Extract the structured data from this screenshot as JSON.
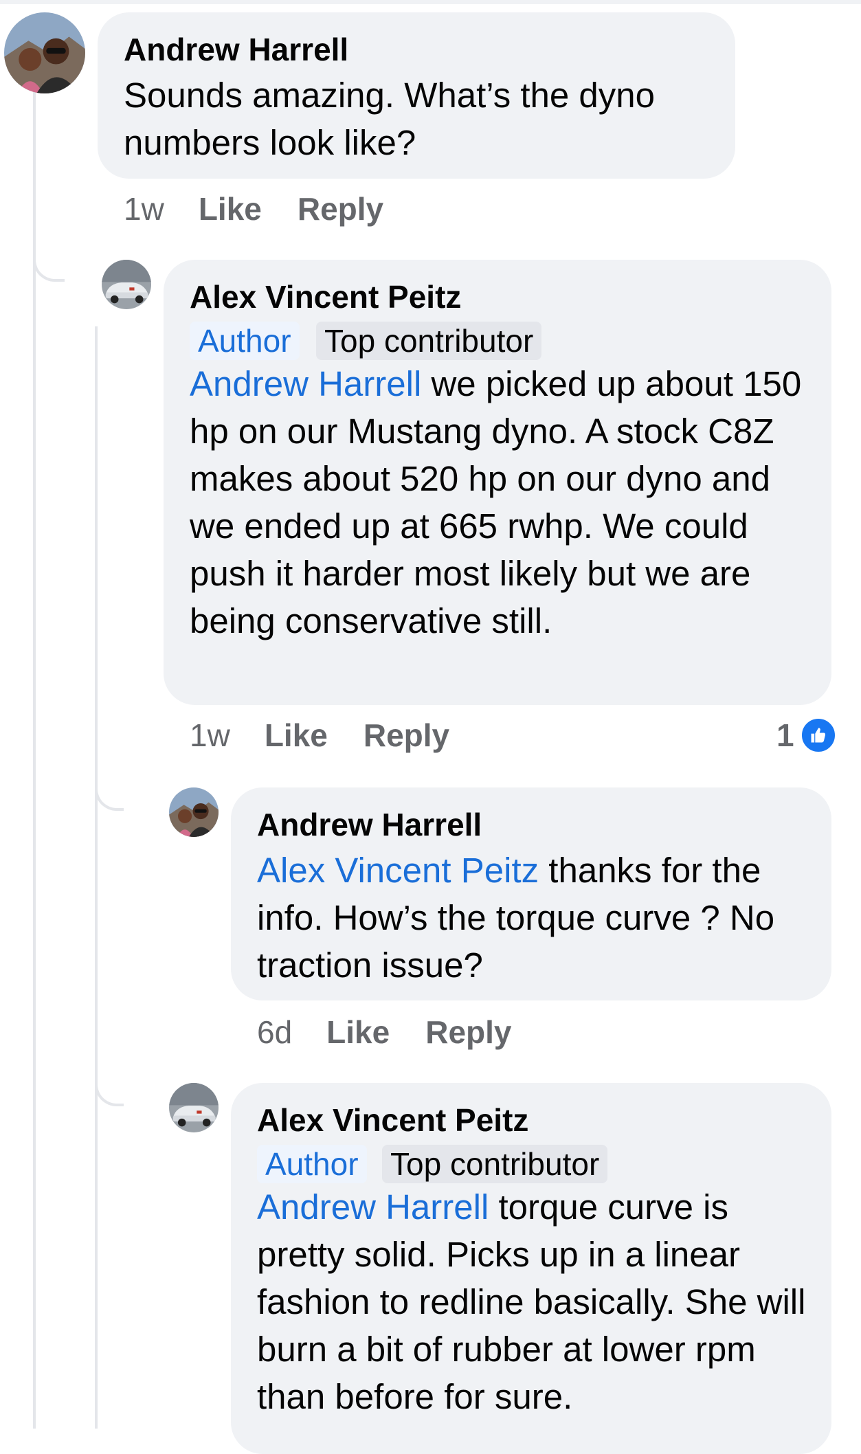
{
  "comments": [
    {
      "author": "Andrew Harrell",
      "avatar_icon": "couple-selfie-avatar",
      "text": "Sounds amazing. What’s the dyno numbers look like?",
      "time": "1w",
      "like_label": "Like",
      "reply_label": "Reply"
    },
    {
      "author": "Alex Vincent Peitz",
      "avatar_icon": "car-avatar",
      "badges": [
        "Author",
        "Top contributor"
      ],
      "mention": "Andrew Harrell",
      "text": " we picked up about 150 hp on our Mustang dyno. A stock C8Z makes about 520 hp on our dyno and we ended up at 665 rwhp. We could push it harder most likely but we are being conservative still.",
      "time": "1w",
      "like_label": "Like",
      "reply_label": "Reply",
      "reaction_count": "1",
      "reaction_icon": "like-thumb-icon"
    },
    {
      "author": "Andrew Harrell",
      "avatar_icon": "couple-selfie-avatar",
      "mention": "Alex Vincent Peitz",
      "text": " thanks for the info. How’s the torque curve ? No traction issue?",
      "time": "6d",
      "like_label": "Like",
      "reply_label": "Reply"
    },
    {
      "author": "Alex Vincent Peitz",
      "avatar_icon": "car-avatar",
      "badges": [
        "Author",
        "Top contributor"
      ],
      "mention": "Andrew Harrell",
      "text": " torque curve is pretty solid. Picks up in a linear fashion to redline basically. She will burn a bit of rubber at lower rpm than before for sure."
    }
  ],
  "colors": {
    "bubble": "#f0f2f5",
    "mention": "#1a6ed8",
    "meta": "#65676b",
    "like_blue": "#1877f2",
    "thread_line": "#e4e6ea"
  }
}
